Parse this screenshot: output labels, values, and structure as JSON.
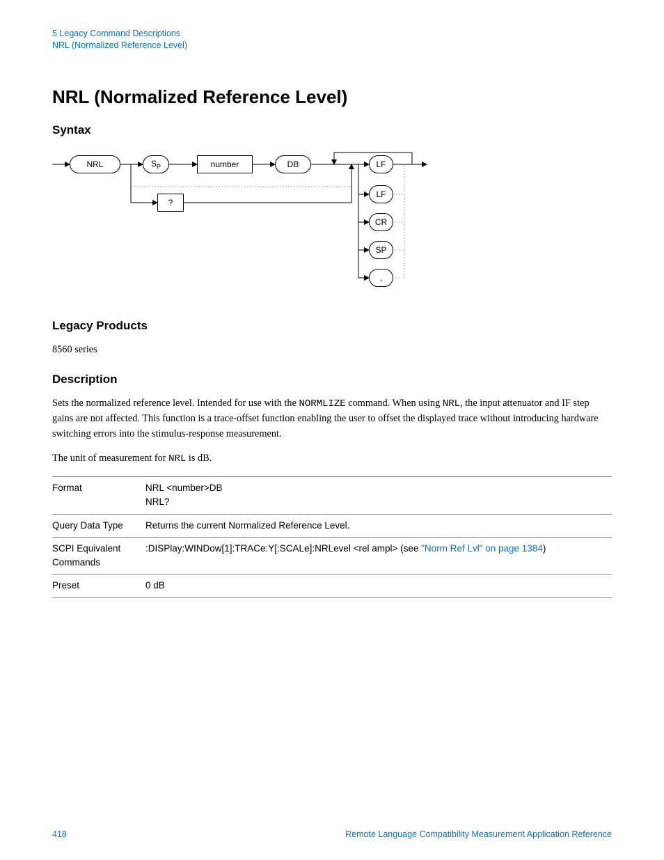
{
  "header": {
    "line1": "5  Legacy Command Descriptions",
    "line2": "NRL (Normalized Reference Level)"
  },
  "title": "NRL (Normalized Reference Level)",
  "sections": {
    "syntax": "Syntax",
    "legacy": "Legacy Products",
    "desc": "Description"
  },
  "diagram": {
    "nrl": "NRL",
    "sp": "S",
    "sp_sub": "P",
    "number": "number",
    "db": "DB",
    "q": "?",
    "lf": "LF",
    "lf2": "LF",
    "cr": "CR",
    "sp2": "SP",
    "comma": ","
  },
  "legacy_text": "8560 series",
  "description": {
    "p1a": "Sets the normalized reference level. Intended for use with the ",
    "p1m": "NORMLIZE",
    "p1b": " command. When using ",
    "p1m2": "NRL",
    "p1c": ", the input attenuator and IF step gains are not affected. This function is a trace-offset function enabling the user to offset the displayed trace without introducing hardware switching errors into the stimulus-response measurement.",
    "p2a": "The unit of measurement for ",
    "p2m": "NRL",
    "p2b": " is dB."
  },
  "table": {
    "r1": {
      "label": "Format",
      "v1": "NRL <number>DB",
      "v2": "NRL?"
    },
    "r2": {
      "label": "Query Data Type",
      "v": "Returns the current Normalized Reference Level."
    },
    "r3": {
      "label": "SCPI Equivalent Commands",
      "v1": ":DISPlay:WINDow[1]:TRACe:Y[:SCALe]:NRLevel <rel ampl> (see ",
      "link": "\"Norm Ref Lvl\" on page 1384",
      "v2": ")"
    },
    "r4": {
      "label": "Preset",
      "v": "0 dB"
    }
  },
  "footer": {
    "page": "418",
    "ref": "Remote Language Compatibility Measurement Application Reference"
  }
}
